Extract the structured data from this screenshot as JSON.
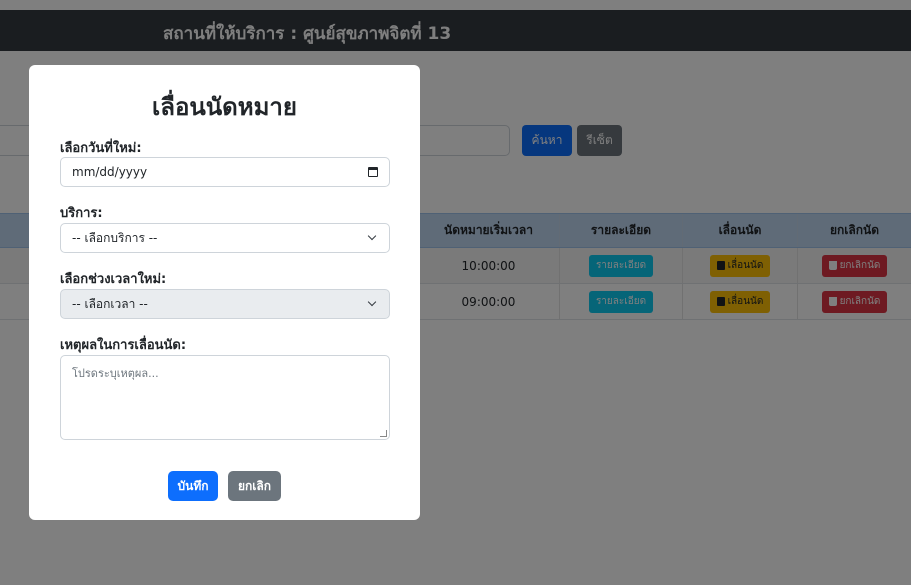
{
  "header": {
    "title": "สถานที่ให้บริการ : ศูนย์สุขภาพจิตที่ 13"
  },
  "search": {
    "search_label": "ค้นหา",
    "reset_label": "รีเซ็ต"
  },
  "table": {
    "headers": [
      "",
      "นัดหมายเริ่มเวลา",
      "รายละเอียด",
      "เลื่อนนัด",
      "ยกเลิกนัด"
    ],
    "rows": [
      {
        "start_time": "10:00:00",
        "detail": "รายละเอียด",
        "move": "เลื่อนนัด",
        "cancel": "ยกเลิกนัด"
      },
      {
        "start_time": "09:00:00",
        "detail": "รายละเอียด",
        "move": "เลื่อนนัด",
        "cancel": "ยกเลิกนัด"
      }
    ]
  },
  "modal": {
    "title": "เลื่อนนัดหมาย",
    "date_label": "เลือกวันที่ใหม่:",
    "date_placeholder": "mm/dd/yyyy",
    "service_label": "บริการ:",
    "service_value": "-- เลือกบริการ --",
    "time_label": "เลือกช่วงเวลาใหม่:",
    "time_value": "-- เลือกเวลา --",
    "reason_label": "เหตุผลในการเลื่อนนัด:",
    "reason_placeholder": "โปรดระบุเหตุผล...",
    "save_label": "บันทึก",
    "cancel_label": "ยกเลิก"
  },
  "colors": {
    "primary": "#0d6efd",
    "secondary": "#6c757d",
    "info": "#0dcaf0",
    "warning": "#ffc107",
    "danger": "#dc3545",
    "topbar": "#343a40"
  },
  "icons": [
    "calendar-icon",
    "chevron-down-icon",
    "trash-icon"
  ]
}
